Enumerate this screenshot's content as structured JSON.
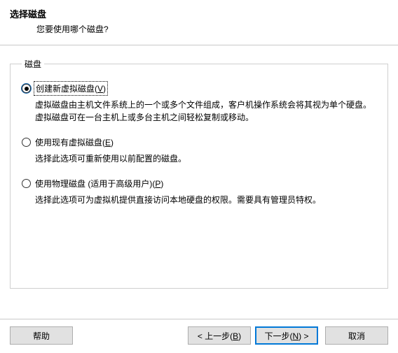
{
  "header": {
    "title": "选择磁盘",
    "subtitle": "您要使用哪个磁盘?"
  },
  "group": {
    "legend": "磁盘"
  },
  "options": {
    "create": {
      "label_pre": "创建新虚拟磁盘(",
      "hotkey": "V",
      "label_post": ")",
      "desc": "虚拟磁盘由主机文件系统上的一个或多个文件组成，客户机操作系统会将其视为单个硬盘。虚拟磁盘可在一台主机上或多台主机之间轻松复制或移动。",
      "selected": true
    },
    "existing": {
      "label_pre": "使用现有虚拟磁盘(",
      "hotkey": "E",
      "label_post": ")",
      "desc": "选择此选项可重新使用以前配置的磁盘。",
      "selected": false
    },
    "physical": {
      "label_pre": "使用物理磁盘 (适用于高级用户)(",
      "hotkey": "P",
      "label_post": ")",
      "desc": "选择此选项可为虚拟机提供直接访问本地硬盘的权限。需要具有管理员特权。",
      "selected": false
    }
  },
  "buttons": {
    "help": "帮助",
    "back_pre": "< 上一步(",
    "back_hk": "B",
    "back_post": ")",
    "next_pre": "下一步(",
    "next_hk": "N",
    "next_post": ") >",
    "cancel": "取消"
  }
}
